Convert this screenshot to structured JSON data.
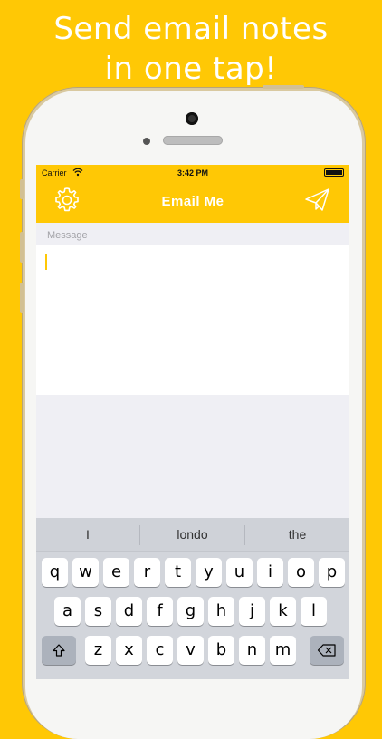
{
  "promo": {
    "line1": "Send email notes",
    "line2": "in one tap!"
  },
  "status_bar": {
    "carrier": "Carrier",
    "time": "3:42 PM"
  },
  "nav_bar": {
    "title": "Email Me",
    "left_icon": "gear-icon",
    "right_icon": "paper-plane-icon"
  },
  "message": {
    "label": "Message",
    "value": ""
  },
  "keyboard": {
    "suggestions": [
      "I",
      "londo",
      "the"
    ],
    "row1": [
      "q",
      "w",
      "e",
      "r",
      "t",
      "y",
      "u",
      "i",
      "o",
      "p"
    ],
    "row2": [
      "a",
      "s",
      "d",
      "f",
      "g",
      "h",
      "j",
      "k",
      "l"
    ],
    "row3": [
      "z",
      "x",
      "c",
      "v",
      "b",
      "n",
      "m"
    ],
    "shift_icon": "shift-arrow-icon",
    "delete_icon": "backspace-icon"
  },
  "colors": {
    "accent": "#FFC805",
    "background": "#FFC805",
    "keyboard_bg": "#D2D5DB"
  }
}
